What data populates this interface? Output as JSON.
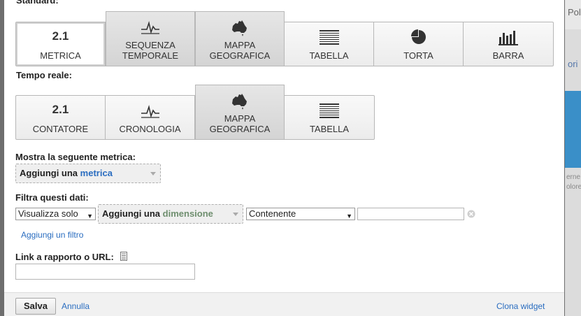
{
  "standard": {
    "label": "Standard:",
    "tabs": [
      {
        "label": "METRICA",
        "icon": "2.1"
      },
      {
        "label": "SEQUENZA\nTEMPORALE",
        "icon": "line-chart-icon"
      },
      {
        "label": "MAPPA\nGEOGRAFICA",
        "icon": "australia-map-icon"
      },
      {
        "label": "TABELLA",
        "icon": "table-icon"
      },
      {
        "label": "TORTA",
        "icon": "pie-chart-icon"
      },
      {
        "label": "BARRA",
        "icon": "bar-chart-icon"
      }
    ]
  },
  "realtime": {
    "label": "Tempo reale:",
    "tabs": [
      {
        "label": "CONTATORE",
        "icon": "2.1"
      },
      {
        "label": "CRONOLOGIA",
        "icon": "line-chart-icon"
      },
      {
        "label": "MAPPA\nGEOGRAFICA",
        "icon": "australia-map-icon"
      },
      {
        "label": "TABELLA",
        "icon": "table-icon"
      }
    ]
  },
  "metric": {
    "label": "Mostra la seguente metrica:",
    "add_prefix": "Aggiungi una",
    "add_accent": "metrica"
  },
  "filter": {
    "label": "Filtra questi dati:",
    "mode_value": "Visualizza solo",
    "add_prefix": "Aggiungi una",
    "add_accent": "dimensione",
    "match_value": "Contenente",
    "value_input": "",
    "add_filter_link": "Aggiungi un filtro"
  },
  "link": {
    "label": "Link a rapporto o URL:",
    "value": ""
  },
  "footer": {
    "save": "Salva",
    "cancel": "Annulla",
    "clone": "Clona widget"
  },
  "backdrop": {
    "top_text": "Pol",
    "link_text": "ori",
    "line1": "erne",
    "line2": "olore"
  },
  "colors": {
    "link": "#2a6dc0",
    "dimension_accent": "#6f8f6f"
  }
}
